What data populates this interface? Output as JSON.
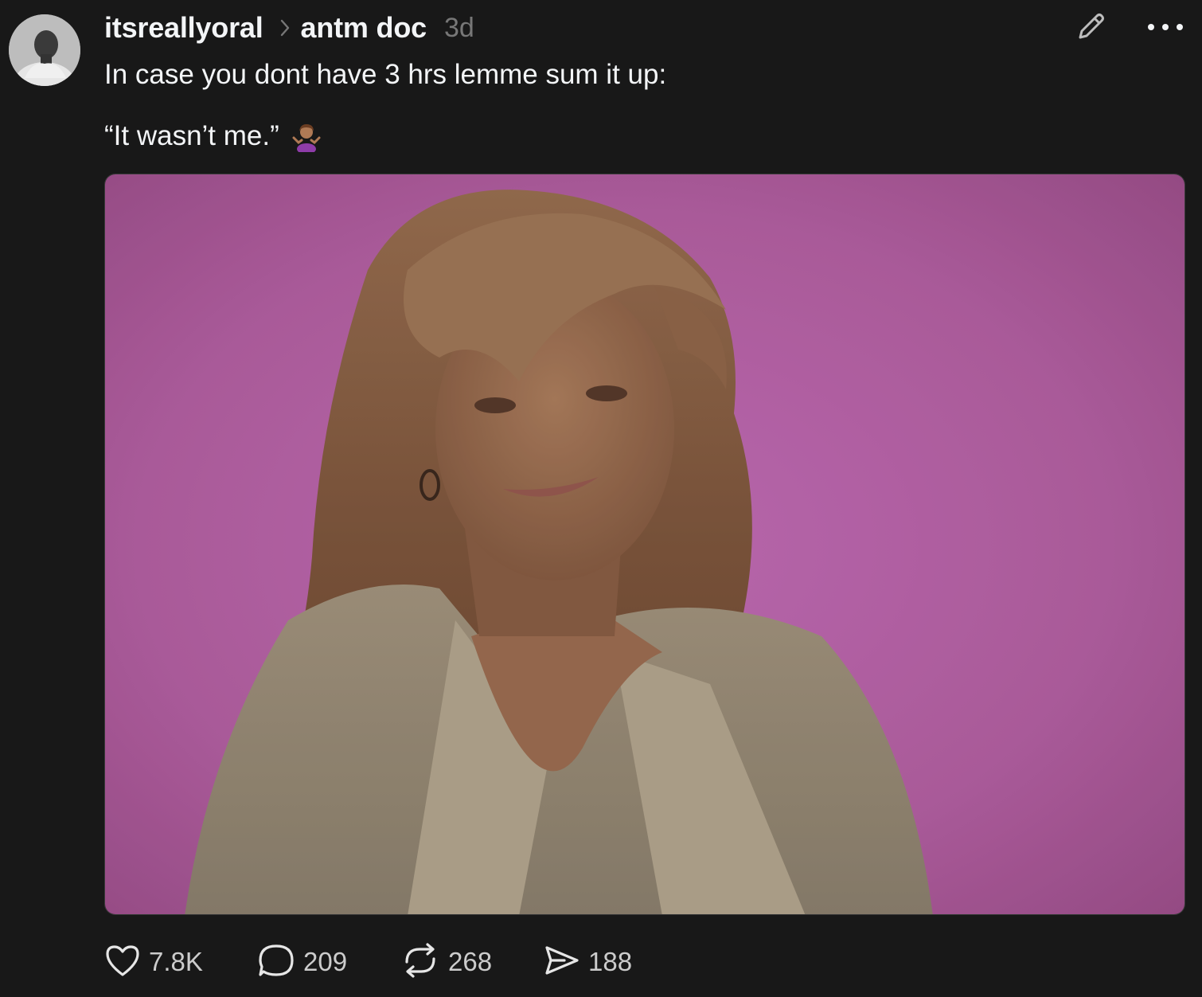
{
  "post": {
    "author": "itsreallyoral",
    "topic": "antm doc",
    "timestamp": "3d",
    "text_line1": "In case you dont have 3 hrs lemme sum it up:",
    "text_line2": "“It wasn’t me.”",
    "emoji": "person-shrugging-emoji",
    "image_description_icon": "post-photo"
  },
  "actions": {
    "likes": "7.8K",
    "replies": "209",
    "reposts": "268",
    "shares": "188"
  },
  "icons": {
    "edit": "pencil-icon",
    "more": "more-dots-icon",
    "like": "heart-icon",
    "reply": "speech-bubble-icon",
    "repost": "repost-icon",
    "share": "send-icon",
    "separator": "chevron-right-icon"
  },
  "colors": {
    "background": "#181818",
    "text_primary": "#f3f5f7",
    "text_secondary": "#777777",
    "counts": "#cccccc",
    "photo_backdrop": "#c266b0"
  }
}
